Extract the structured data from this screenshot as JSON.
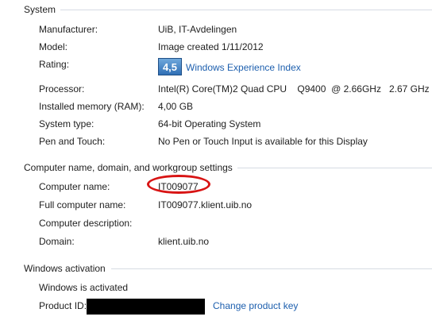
{
  "sections": {
    "system": {
      "title": "System",
      "rows": [
        {
          "label": "Manufacturer:",
          "value": "UiB, IT-Avdelingen"
        },
        {
          "label": "Model:",
          "value": "Image created 1/11/2012"
        },
        {
          "label": "Rating:",
          "value": "Windows Experience Index"
        },
        {
          "label": "Processor:",
          "value": "Intel(R) Core(TM)2 Quad CPU    Q9400  @ 2.66GHz   2.67 GHz"
        },
        {
          "label": "Installed memory (RAM):",
          "value": "4,00 GB"
        },
        {
          "label": "System type:",
          "value": "64-bit Operating System"
        },
        {
          "label": "Pen and Touch:",
          "value": "No Pen or Touch Input is available for this Display"
        }
      ],
      "rating_score": "4,5"
    },
    "computer": {
      "title": "Computer name, domain, and workgroup settings",
      "rows": [
        {
          "label": "Computer name:",
          "value": "IT009077"
        },
        {
          "label": "Full computer name:",
          "value": "IT009077.klient.uib.no"
        },
        {
          "label": "Computer description:",
          "value": ""
        },
        {
          "label": "Domain:",
          "value": "klient.uib.no"
        }
      ]
    },
    "activation": {
      "title": "Windows activation",
      "status": "Windows is activated",
      "product_id_label": "Product ID:",
      "change_key_link": "Change product key"
    }
  },
  "colors": {
    "link": "#1d5fae",
    "highlight_circle": "#d81414",
    "separator": "#d6dbe3"
  }
}
